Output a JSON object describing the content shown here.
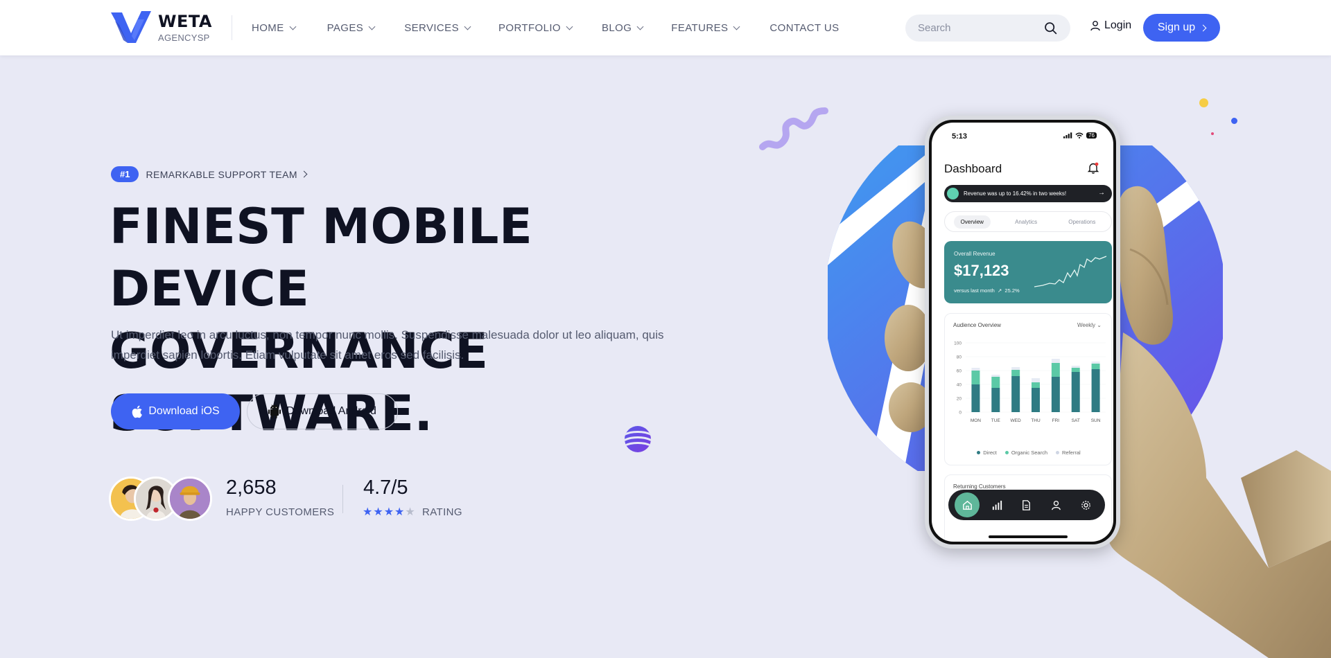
{
  "brand": {
    "name": "WETA",
    "sub": "AGENCYSP",
    "accent": "#3e63f2"
  },
  "nav": [
    {
      "label": "HOME",
      "has_dropdown": true
    },
    {
      "label": "PAGES",
      "has_dropdown": true
    },
    {
      "label": "SERVICES",
      "has_dropdown": true
    },
    {
      "label": "PORTFOLIO",
      "has_dropdown": true
    },
    {
      "label": "BLOG",
      "has_dropdown": true
    },
    {
      "label": "FEATURES",
      "has_dropdown": true
    },
    {
      "label": "CONTACT US",
      "has_dropdown": false
    }
  ],
  "header": {
    "search_placeholder": "Search",
    "search_icon": "search-icon",
    "login_label": "Login",
    "login_icon": "user-icon",
    "signup_label": "Sign up"
  },
  "hero": {
    "badge_number": "#1",
    "badge_text": "REMARKABLE SUPPORT TEAM",
    "title_line1": "FINEST MOBILE DEVICE",
    "title_line2": "GOVERNANCE SOFTWARE.",
    "description": "Ut imperdiet leo in arcu luctus, non tempor nunc mollis. Suspendisse malesuada dolor ut leo aliquam, quis imperdiet sapien lobortis. Etiam vulputate sit amet eros sed facilisis.",
    "btn_ios": "Download iOS",
    "btn_android": "Download Android",
    "customers_count": "2,658",
    "customers_label": "HAPPY CUSTOMERS",
    "rating_value": "4.7/5",
    "rating_label": "RATING",
    "rating_stars_filled": 4,
    "rating_stars_total": 5
  },
  "phone": {
    "time": "5:13",
    "battery": "76",
    "dashboard_title": "Dashboard",
    "notification": "Revenue was up to 16.42% in two weeks!",
    "tabs": [
      "Overview",
      "Analytics",
      "Operations"
    ],
    "active_tab": "Overview",
    "revenue_label": "Overall Revenue",
    "revenue_value": "$17,123",
    "revenue_compare": "versus last month",
    "revenue_change": "25.2%",
    "audience_title": "Audience Overview",
    "audience_period": "Weekly",
    "legend": [
      "Direct",
      "Organic Search",
      "Referral"
    ],
    "returning_title": "Returning Customers"
  },
  "chart_data": {
    "type": "bar",
    "title": "Audience Overview",
    "categories": [
      "MON",
      "TUE",
      "WED",
      "THU",
      "FRI",
      "SAT",
      "SUN"
    ],
    "ylim": [
      0,
      100
    ],
    "yticks": [
      0,
      20,
      40,
      60,
      80,
      100
    ],
    "series": [
      {
        "name": "Direct",
        "color": "#2f7b83",
        "values": [
          40,
          35,
          52,
          35,
          51,
          58,
          62
        ]
      },
      {
        "name": "Organic Search",
        "color": "#5bc9a6",
        "values": [
          20,
          16,
          9,
          8,
          20,
          6,
          8
        ]
      },
      {
        "name": "Referral",
        "color": "#e6ebf4",
        "values": [
          4,
          3,
          4,
          6,
          6,
          3,
          3
        ]
      }
    ],
    "grid": true,
    "legend": "bottom"
  }
}
